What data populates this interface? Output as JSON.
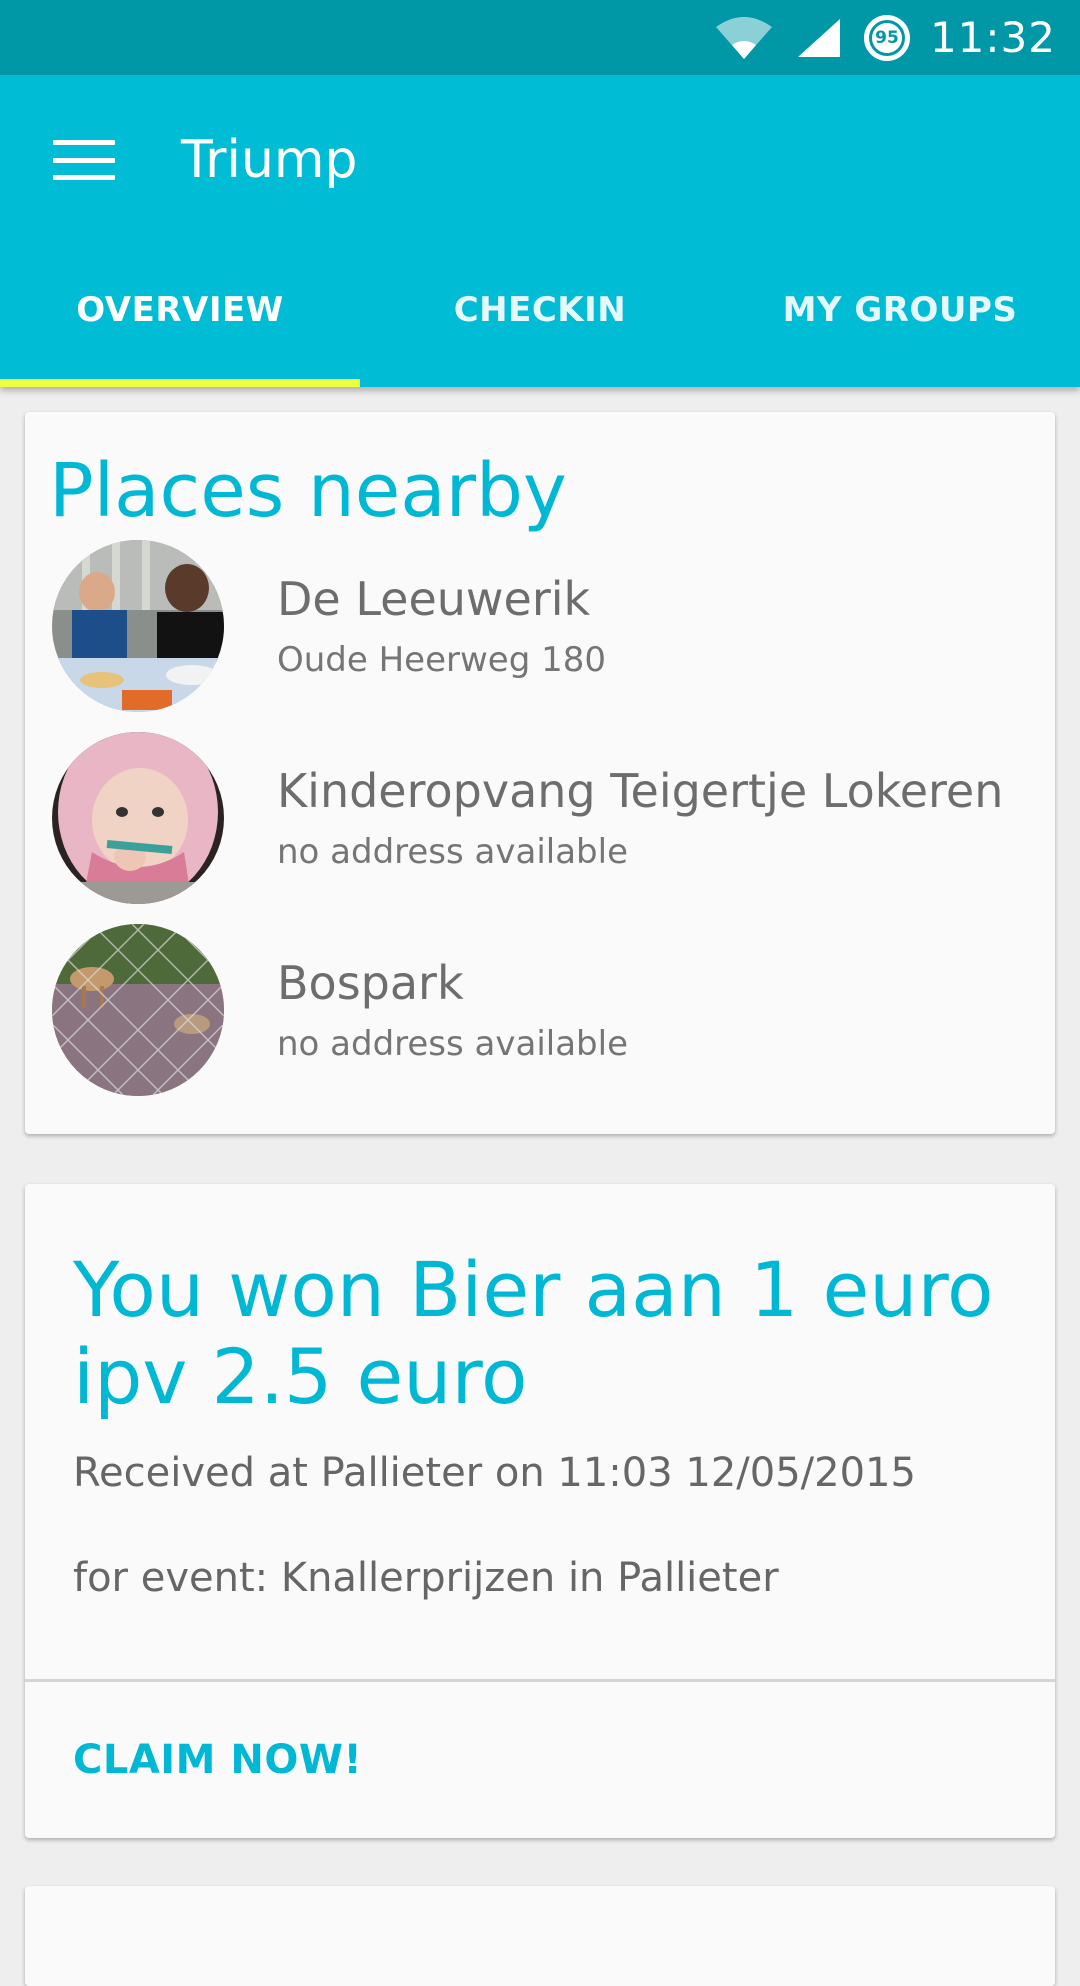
{
  "status_bar": {
    "battery_level": "95",
    "time": "11:32",
    "icons": [
      "wifi-icon",
      "signal-icon",
      "battery-icon"
    ]
  },
  "app_bar": {
    "title": "Triump",
    "menu_icon": "hamburger-menu-icon"
  },
  "tabs": [
    {
      "label": "OVERVIEW",
      "selected": true
    },
    {
      "label": "CHECKIN",
      "selected": false
    },
    {
      "label": "MY GROUPS",
      "selected": false
    }
  ],
  "places_card": {
    "title": "Places nearby",
    "items": [
      {
        "name": "De Leeuwerik",
        "address": "Oude Heerweg 180"
      },
      {
        "name": "Kinderopvang Teigertje Lokeren",
        "address": "no address available"
      },
      {
        "name": "Bospark",
        "address": "no address available"
      }
    ]
  },
  "prize_card": {
    "title": "You won Bier aan 1 euro ipv 2.5 euro",
    "received": "Received at Pallieter on 11:03 12/05/2015",
    "event": "for event: Knallerprijzen in Pallieter",
    "claim_label": "CLAIM NOW!"
  },
  "colors": {
    "status_bar": "#0097a7",
    "app_bar": "#00bcd4",
    "accent": "#00b8d4",
    "tab_indicator": "#eeff41",
    "card_bg": "#fafafa",
    "page_bg": "#eeeeee"
  }
}
